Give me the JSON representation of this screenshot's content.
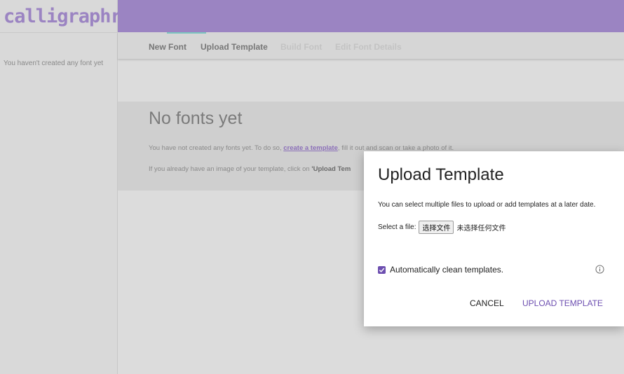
{
  "brand": {
    "logo_text": "calligraphr",
    "accent_color": "#9b84c2",
    "primary_color": "#6d4fb0"
  },
  "sidebar": {
    "empty_message": "You haven't created any font yet"
  },
  "tabs": [
    {
      "label": "New Font",
      "enabled": true
    },
    {
      "label": "Upload Template",
      "enabled": true,
      "active": true
    },
    {
      "label": "Build Font",
      "enabled": false
    },
    {
      "label": "Edit Font Details",
      "enabled": false
    }
  ],
  "content": {
    "title": "No fonts yet",
    "line1_prefix": "You have not created any fonts yet. To do so, ",
    "line1_link": "create a template",
    "line1_suffix": ", fill it out and scan or take a photo of it.",
    "line2_prefix": "If you already have an image of your template, click on ",
    "line2_bold": "'Upload Tem"
  },
  "dialog": {
    "title": "Upload Template",
    "description": "You can select multiple files to upload or add templates at a later date.",
    "file_label": "Select a file:",
    "file_button": "选择文件",
    "file_status": "未选择任何文件",
    "auto_clean_label": "Automatically clean templates.",
    "auto_clean_checked": true,
    "info_icon": "info-circle-icon",
    "cancel_label": "CANCEL",
    "upload_label": "UPLOAD TEMPLATE"
  }
}
